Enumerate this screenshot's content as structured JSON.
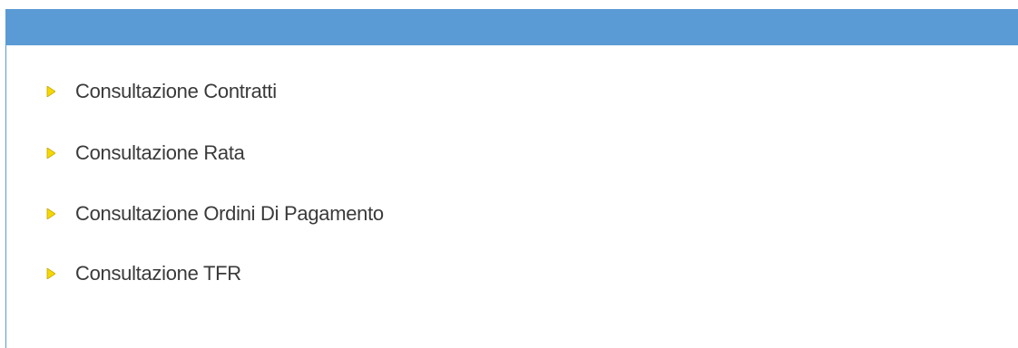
{
  "colors": {
    "header_bar": "#5b9bd5",
    "arrow": "#f5d800",
    "text": "#3a3a3a"
  },
  "menu": {
    "items": [
      {
        "label": "Consultazione Contratti",
        "icon": "triangle-right-icon"
      },
      {
        "label": "Consultazione Rata",
        "icon": "triangle-right-icon"
      },
      {
        "label": "Consultazione Ordini Di Pagamento",
        "icon": "triangle-right-icon"
      },
      {
        "label": "Consultazione TFR",
        "icon": "triangle-right-icon"
      }
    ]
  }
}
